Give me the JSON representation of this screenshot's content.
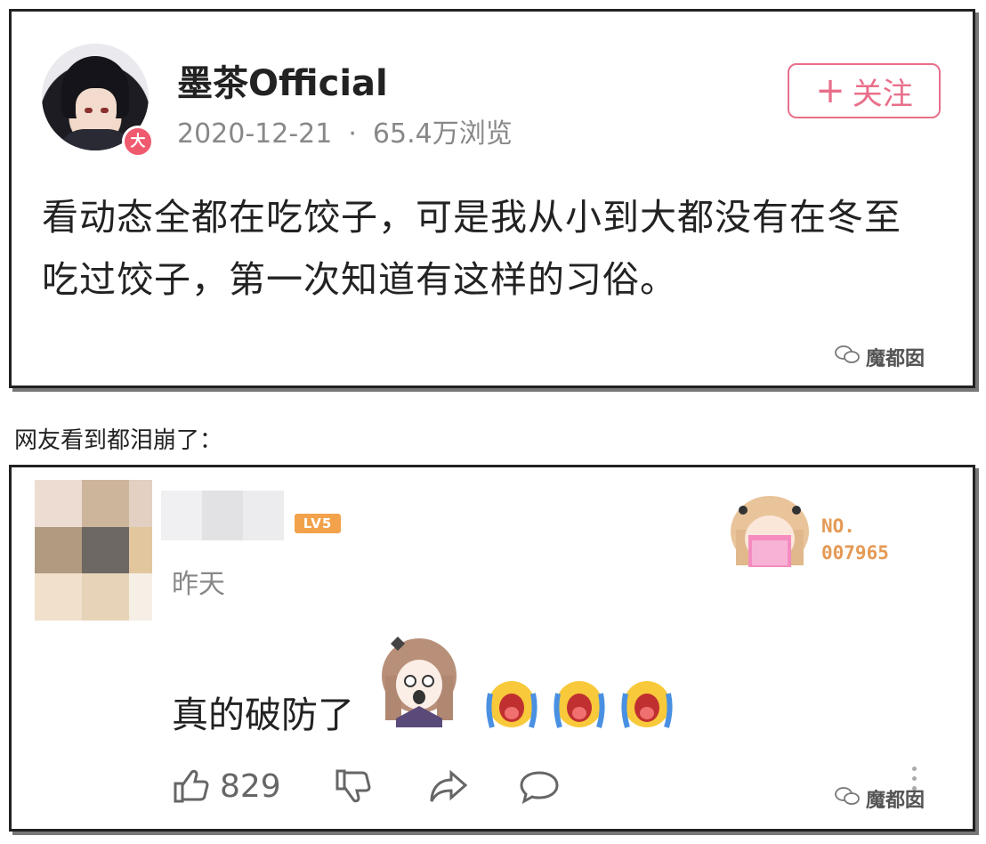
{
  "post": {
    "username": "墨茶Official",
    "avatar_badge": "大",
    "date": "2020-12-21",
    "meta_separator": "·",
    "views": "65.4万浏览",
    "follow_label": "关注",
    "follow_icon": "plus-icon",
    "text": "看动态全都在吃饺子，可是我从小到大都没有在冬至吃过饺子，第一次知道有这样的习俗。",
    "watermark": "魔都囡"
  },
  "caption": "网友看到都泪崩了：",
  "comment": {
    "level_badge": "LV5",
    "time": "昨天",
    "fan_label": "NO.",
    "fan_number": "007965",
    "text": "真的破防了",
    "cry_emoji_count": 3,
    "like_count": "829",
    "watermark": "魔都囡"
  },
  "colors": {
    "accent_pink": "#e86f8a",
    "level_orange": "#f2a24a",
    "fan_orange": "#e59a55",
    "meta_gray": "#888888"
  },
  "icons": {
    "like": "thumb-up-icon",
    "dislike": "thumb-down-icon",
    "share": "share-arrow-icon",
    "reply": "comment-bubble-icon",
    "watermark": "wechat-icon"
  }
}
